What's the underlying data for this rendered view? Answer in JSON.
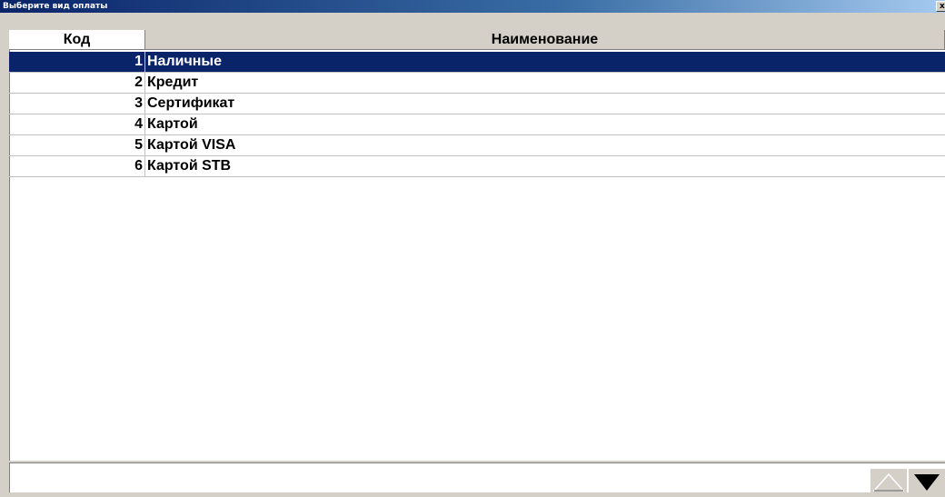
{
  "window": {
    "title": "Выберите вид оплаты",
    "close_label": "x"
  },
  "table": {
    "columns": [
      "Код",
      "Наименование"
    ],
    "rows": [
      {
        "code": "1",
        "name": "Наличные"
      },
      {
        "code": "2",
        "name": "Кредит"
      },
      {
        "code": "3",
        "name": "Сертификат"
      },
      {
        "code": "4",
        "name": "Картой"
      },
      {
        "code": "5",
        "name": "Картой VISA"
      },
      {
        "code": "6",
        "name": "Картой STB"
      }
    ],
    "selected_index": 0
  },
  "scroll": {
    "up_icon": "triangle-up-outline-icon",
    "down_icon": "triangle-down-filled-icon"
  },
  "colors": {
    "selection": "#0a246a",
    "title_gradient_start": "#0a246a",
    "title_gradient_end": "#a6caf0",
    "face": "#d4d0c8"
  }
}
